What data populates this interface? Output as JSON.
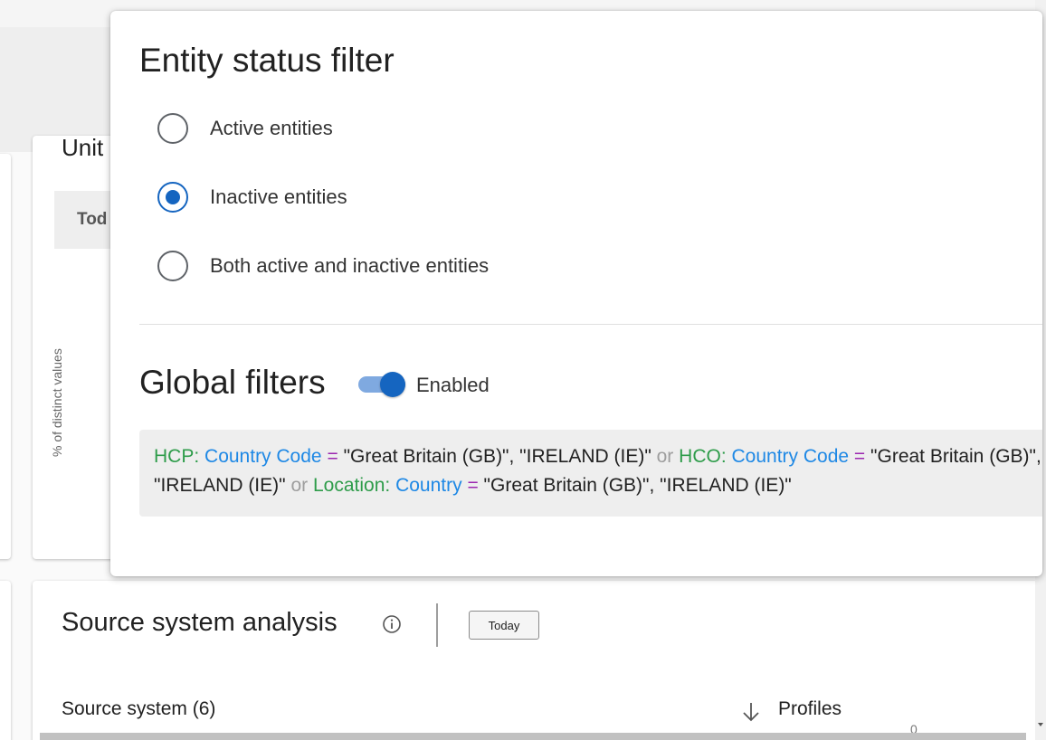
{
  "background": {
    "card_top_title_partial": "Unit",
    "tab_label_partial": "Tod",
    "axis_label": "% of distinct values",
    "source_system_analysis": {
      "title": "Source system analysis",
      "info_icon": "info-circle-icon",
      "today_button": "Today",
      "column_source": "Source system (6)",
      "column_profiles": "Profiles",
      "sort_icon": "arrow-down-icon",
      "zero_label": "0"
    }
  },
  "popup": {
    "title": "Entity status filter",
    "radios": [
      {
        "label": "Active entities",
        "checked": false
      },
      {
        "label": "Inactive entities",
        "checked": true
      },
      {
        "label": "Both active and inactive entities",
        "checked": false
      }
    ],
    "global_filters": {
      "title": "Global filters",
      "toggle_on": true,
      "toggle_label": "Enabled",
      "line1": {
        "e1": "HCP:",
        "a1": "Country Code",
        "op1": "=",
        "v1": "\"Great Britain (GB)\", \"IRELAND (IE)\"",
        "or1": "or",
        "e2": "HCO:",
        "a2": "Country Code",
        "op2": "=",
        "v2": "\"Great Britain (GB)\","
      },
      "line2": {
        "v2b": "\"IRELAND (IE)\"",
        "or2": "or",
        "e3": "Location:",
        "a3": "Country",
        "op3": "=",
        "v3": "\"Great Britain (GB)\", \"IRELAND (IE)\""
      }
    }
  },
  "colors": {
    "accent": "#1565c0",
    "filter_entity": "#2e9c4a",
    "filter_attribute": "#1e88e5",
    "filter_operator": "#9c27b0",
    "filter_or": "#9e9e9e"
  }
}
